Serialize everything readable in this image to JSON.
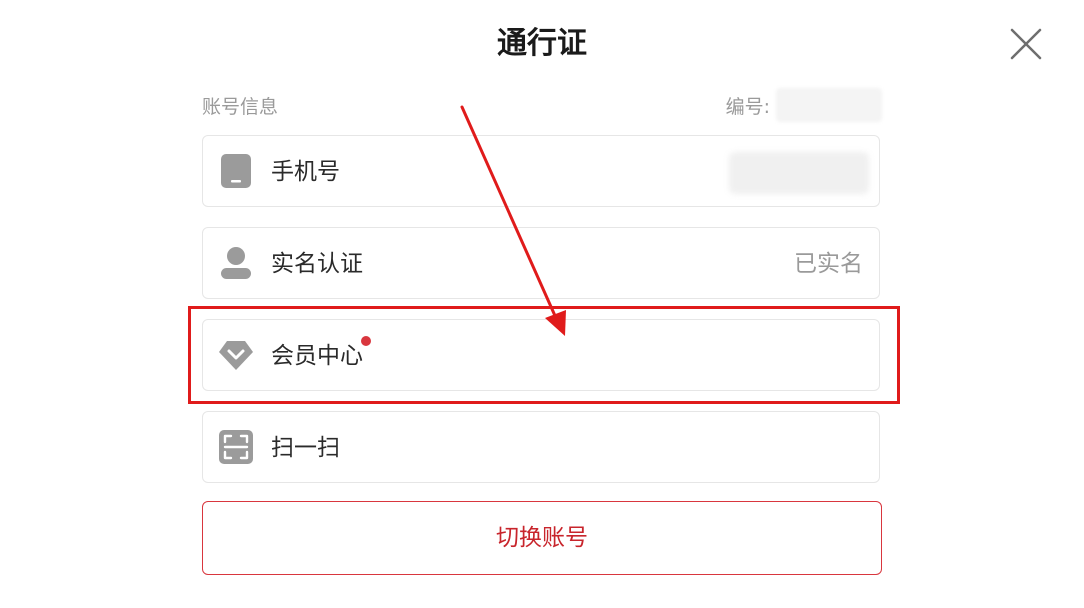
{
  "header": {
    "title": "通行证",
    "close_icon": "close-icon"
  },
  "account_section": {
    "label": "账号信息",
    "number_label": "编号:"
  },
  "items": [
    {
      "icon": "phone-icon",
      "label": "手机号",
      "value": ""
    },
    {
      "icon": "user-icon",
      "label": "实名认证",
      "value": "已实名"
    },
    {
      "icon": "diamond-icon",
      "label": "会员中心",
      "value": "",
      "badge": true
    },
    {
      "icon": "scan-icon",
      "label": "扫一扫",
      "value": ""
    }
  ],
  "switch_button": {
    "label": "切换账号"
  },
  "colors": {
    "accent": "#d9363e",
    "annotation": "#e01b1b",
    "icon_gray": "#9b9b9b",
    "text_primary": "#2a2a2a",
    "text_secondary": "#9a9a9a"
  }
}
